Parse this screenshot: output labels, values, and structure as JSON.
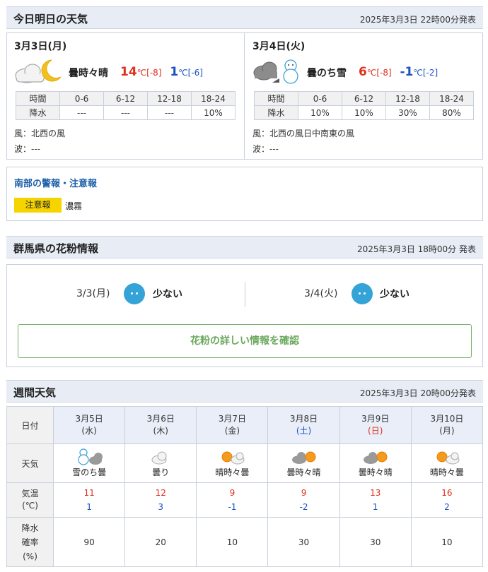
{
  "today_section": {
    "title": "今日明日の天気",
    "issued": "2025年3月3日 22時00分発表",
    "days": [
      {
        "date": "3月3日(月)",
        "icon": "cloud-moon-icon",
        "weather": "曇時々晴",
        "high": "14",
        "high_diff": "[-8]",
        "low": "1",
        "low_diff": "[-6]",
        "temp_unit": "℃",
        "rain_header_label": "時間",
        "rain_row_label": "降水",
        "rain_periods": [
          "0-6",
          "6-12",
          "12-18",
          "18-24"
        ],
        "rain_values": [
          "---",
          "---",
          "---",
          "10%"
        ],
        "wind": "風：北西の風",
        "wave": "波：---"
      },
      {
        "date": "3月4日(火)",
        "icon": "cloud-snowman-icon",
        "weather": "曇のち雪",
        "high": "6",
        "high_diff": "[-8]",
        "low": "-1",
        "low_diff": "[-2]",
        "temp_unit": "℃",
        "rain_header_label": "時間",
        "rain_row_label": "降水",
        "rain_periods": [
          "0-6",
          "6-12",
          "12-18",
          "18-24"
        ],
        "rain_values": [
          "10%",
          "10%",
          "30%",
          "80%"
        ],
        "wind": "風：北西の風日中南東の風",
        "wave": "波：---"
      }
    ]
  },
  "alert": {
    "title": "南部の警報・注意報",
    "badge": "注意報",
    "text": "濃霧",
    "badge_color": "#f6d400"
  },
  "pollen_section": {
    "title": "群馬県の花粉情報",
    "issued": "2025年3月3日 18時00分 発表",
    "days": [
      {
        "date": "3/3(月)",
        "level": "少ない"
      },
      {
        "date": "3/4(火)",
        "level": "少ない"
      }
    ],
    "button_label": "花粉の詳しい情報を確認"
  },
  "weekly_section": {
    "title": "週間天気",
    "issued": "2025年3月3日 20時00分発表",
    "row_labels": {
      "date": "日付",
      "weather": "天気",
      "temp_line1": "気温",
      "temp_line2": "(℃)",
      "rain_line1": "降水",
      "rain_line2": "確率",
      "rain_line3": "(%)"
    },
    "days": [
      {
        "date": "3月5日",
        "dow": "(水)",
        "dow_type": "weekday",
        "icon": "snowman-cloud-icon",
        "weather": "雪のち曇",
        "high": "11",
        "low": "1",
        "rain": "90"
      },
      {
        "date": "3月6日",
        "dow": "(木)",
        "dow_type": "weekday",
        "icon": "cloud-icon",
        "weather": "曇り",
        "high": "12",
        "low": "3",
        "rain": "20"
      },
      {
        "date": "3月7日",
        "dow": "(金)",
        "dow_type": "weekday",
        "icon": "sun-cloud-icon",
        "weather": "晴時々曇",
        "high": "9",
        "low": "-1",
        "rain": "10"
      },
      {
        "date": "3月8日",
        "dow": "(土)",
        "dow_type": "sat",
        "icon": "cloud-sun-icon",
        "weather": "曇時々晴",
        "high": "9",
        "low": "-2",
        "rain": "30"
      },
      {
        "date": "3月9日",
        "dow": "(日)",
        "dow_type": "sun",
        "icon": "cloud-sun-icon",
        "weather": "曇時々晴",
        "high": "13",
        "low": "1",
        "rain": "30"
      },
      {
        "date": "3月10日",
        "dow": "(月)",
        "dow_type": "weekday",
        "icon": "sun-cloud-icon",
        "weather": "晴時々曇",
        "high": "16",
        "low": "2",
        "rain": "10"
      }
    ]
  },
  "colors": {
    "high_temp": "#e0301e",
    "low_temp": "#1b52c2",
    "header_bg": "#e7ecf5",
    "link_blue": "#1b5fa8",
    "pollen_face": "#33a3d8",
    "pollen_button": "#6aa85d"
  }
}
